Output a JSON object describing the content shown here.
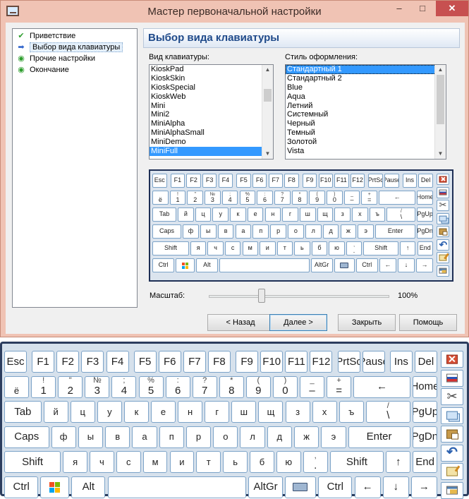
{
  "window": {
    "title": "Мастер первоначальной настройки",
    "min_label": "–",
    "max_label": "□",
    "close_label": "✕"
  },
  "steps": [
    {
      "label": "Приветствие",
      "icon": "check-icon",
      "glyph": "✔",
      "color": "#2e9e2e"
    },
    {
      "label": "Выбор вида клавиатуры",
      "icon": "arrow-right-icon",
      "glyph": "➡",
      "color": "#3366cc"
    },
    {
      "label": "Прочие настройки",
      "icon": "pending-dot-icon",
      "glyph": "◉",
      "color": "#2e9e2e"
    },
    {
      "label": "Окончание",
      "icon": "pending-dot-icon",
      "glyph": "◉",
      "color": "#2e9e2e"
    }
  ],
  "header": {
    "title": "Выбор вида клавиатуры"
  },
  "keyboard_type": {
    "caption": "Вид клавиатуры:",
    "items": [
      "KioskPad",
      "KioskSkin",
      "KioskSpecial",
      "KioskWeb",
      "Mini",
      "Mini2",
      "MiniAlpha",
      "MiniAlphaSmall",
      "MiniDemo",
      "MiniFull"
    ],
    "selected": "MiniFull"
  },
  "style": {
    "caption": "Стиль оформления:",
    "items": [
      "Стандартный 1",
      "Стандартный 2",
      "Blue",
      "Aqua",
      "Летний",
      "Системный",
      "Черный",
      "Темный",
      "Золотой",
      "Vista"
    ],
    "selected": "Стандартный 1"
  },
  "scale": {
    "label": "Масштаб:",
    "value_text": "100%",
    "value": 0.27
  },
  "buttons": {
    "back": "< Назад",
    "next": "Далее >",
    "close": "Закрыть",
    "help": "Помощь"
  },
  "keyboard": {
    "rows": [
      [
        {
          "lo": "Esc"
        },
        {
          "lo": "F1"
        },
        {
          "lo": "F2"
        },
        {
          "lo": "F3"
        },
        {
          "lo": "F4"
        },
        {
          "lo": "F5"
        },
        {
          "lo": "F6"
        },
        {
          "lo": "F7"
        },
        {
          "lo": "F8"
        },
        {
          "lo": "F9"
        },
        {
          "lo": "F10"
        },
        {
          "lo": "F11"
        },
        {
          "lo": "F12"
        },
        {
          "lo": "PrtSc"
        },
        {
          "lo": "Pause"
        },
        {
          "lo": "Ins"
        },
        {
          "lo": "Del"
        }
      ],
      [
        {
          "up": "",
          "lo": "ё"
        },
        {
          "up": "!",
          "lo": "1"
        },
        {
          "up": "\"",
          "lo": "2"
        },
        {
          "up": "№",
          "lo": "3"
        },
        {
          "up": ";",
          "lo": "4"
        },
        {
          "up": "%",
          "lo": "5"
        },
        {
          "up": ":",
          "lo": "6"
        },
        {
          "up": "?",
          "lo": "7"
        },
        {
          "up": "*",
          "lo": "8"
        },
        {
          "up": "(",
          "lo": "9"
        },
        {
          "up": ")",
          "lo": "0"
        },
        {
          "up": "_",
          "lo": "–"
        },
        {
          "up": "+",
          "lo": "="
        },
        {
          "lo": "←"
        },
        {
          "lo": "Home"
        }
      ],
      [
        {
          "lo": "Tab"
        },
        {
          "lo": "й"
        },
        {
          "lo": "ц"
        },
        {
          "lo": "у"
        },
        {
          "lo": "к"
        },
        {
          "lo": "е"
        },
        {
          "lo": "н"
        },
        {
          "lo": "г"
        },
        {
          "lo": "ш"
        },
        {
          "lo": "щ"
        },
        {
          "lo": "з"
        },
        {
          "lo": "х"
        },
        {
          "lo": "ъ"
        },
        {
          "up": "/",
          "lo": "\\"
        },
        {
          "lo": "PgUp"
        }
      ],
      [
        {
          "lo": "Caps"
        },
        {
          "lo": "ф"
        },
        {
          "lo": "ы"
        },
        {
          "lo": "в"
        },
        {
          "lo": "а"
        },
        {
          "lo": "п"
        },
        {
          "lo": "р"
        },
        {
          "lo": "о"
        },
        {
          "lo": "л"
        },
        {
          "lo": "д"
        },
        {
          "lo": "ж"
        },
        {
          "lo": "э"
        },
        {
          "lo": "Enter"
        },
        {
          "lo": "PgDn"
        }
      ],
      [
        {
          "lo": "Shift"
        },
        {
          "lo": "я"
        },
        {
          "lo": "ч"
        },
        {
          "lo": "с"
        },
        {
          "lo": "м"
        },
        {
          "lo": "и"
        },
        {
          "lo": "т"
        },
        {
          "lo": "ь"
        },
        {
          "lo": "б"
        },
        {
          "lo": "ю"
        },
        {
          "up": ",",
          "lo": "."
        },
        {
          "lo": "Shift"
        },
        {
          "lo": "↑"
        },
        {
          "lo": "End"
        }
      ],
      [
        {
          "lo": "Ctrl"
        },
        {
          "lo": "",
          "icon": "windows-logo-icon"
        },
        {
          "lo": "Alt"
        },
        {
          "lo": ""
        },
        {
          "lo": "AltGr"
        },
        {
          "lo": "",
          "icon": "keyboard-icon"
        },
        {
          "lo": "Ctrl"
        },
        {
          "lo": "←"
        },
        {
          "lo": "↓"
        },
        {
          "lo": "→"
        }
      ]
    ],
    "side_icons": [
      "close-icon",
      "language-flag-icon",
      "scissors-icon",
      "copy-icon",
      "paste-icon",
      "undo-icon",
      "notepad-icon",
      "properties-icon"
    ]
  }
}
